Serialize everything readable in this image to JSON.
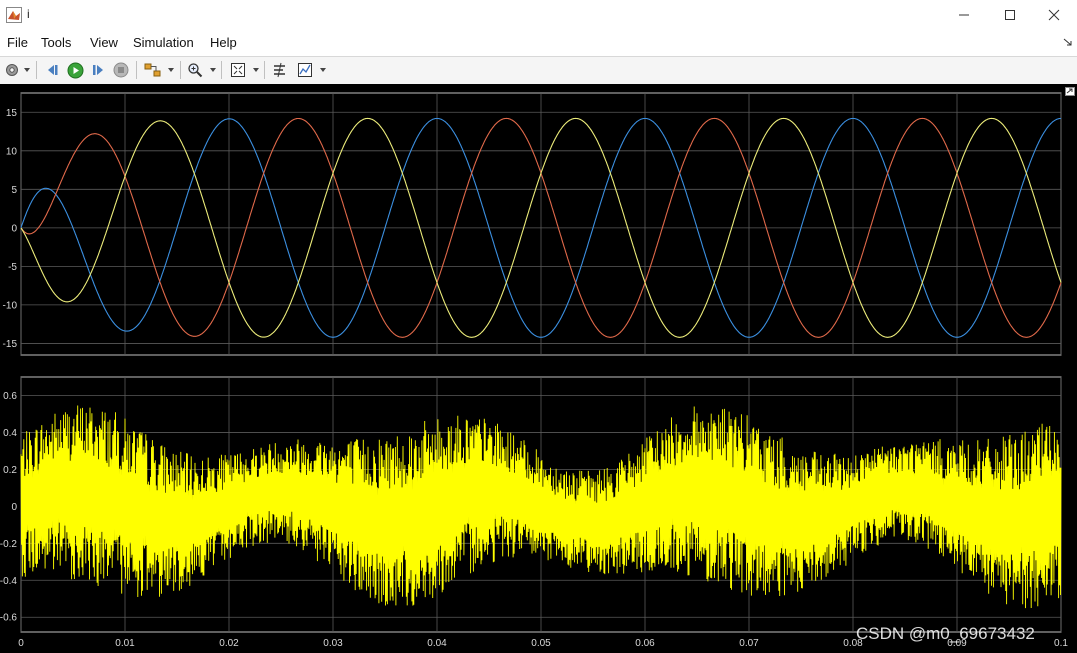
{
  "window": {
    "title": "i"
  },
  "menu": [
    "File",
    "Tools",
    "View",
    "Simulation",
    "Help"
  ],
  "toolbar": {
    "icons": [
      "settings-icon",
      "step-back-icon",
      "run-icon",
      "step-forward-icon",
      "stop-icon",
      "highlight-icon",
      "zoom-icon",
      "autoscale-icon",
      "cursor-measure-icon",
      "signal-stats-icon"
    ]
  },
  "colors": {
    "series_a": "#3b8fe0",
    "series_b": "#e0694a",
    "series_c": "#ecec7a",
    "noise": "#ffff00"
  },
  "watermark": "CSDN @m0_69673432",
  "chart_data": [
    {
      "type": "line",
      "ylim": [
        -16.5,
        17.5
      ],
      "xlim": [
        0,
        0.1
      ],
      "yticks": [
        "15",
        "10",
        "5",
        "0",
        "-5",
        "-10",
        "-15"
      ],
      "grid": true,
      "description_of_series": "three-phase sinusoids, period 0.02, amplitude about 14, with start-up transient",
      "series": [
        {
          "phase_deg": 0,
          "amplitude": 14.2,
          "frequency_hz": 50
        },
        {
          "phase_deg": -120,
          "amplitude": 14.2,
          "frequency_hz": 50
        },
        {
          "phase_deg": 120,
          "amplitude": 14.2,
          "frequency_hz": 50
        }
      ]
    },
    {
      "type": "line",
      "ylim": [
        -0.68,
        0.7
      ],
      "xlim": [
        0,
        0.1
      ],
      "yticks": [
        "0.6",
        "0.4",
        "0.2",
        "0",
        "-0.2",
        "-0.4",
        "-0.6"
      ],
      "xticks": [
        "0",
        "0.01",
        "0.02",
        "0.03",
        "0.04",
        "0.05",
        "0.06",
        "0.07",
        "0.08",
        "0.09",
        "0.1"
      ],
      "grid": true,
      "noise_amplitude": 0.45
    }
  ]
}
